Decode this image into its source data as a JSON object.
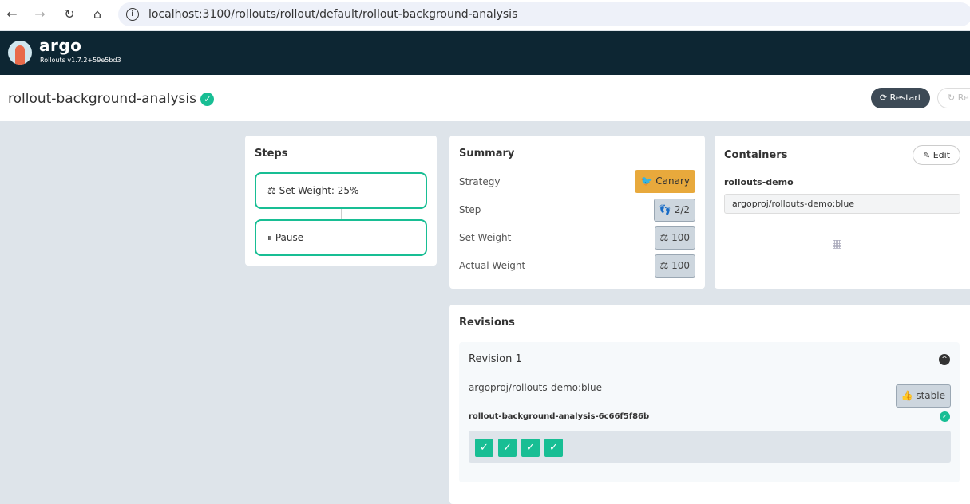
{
  "browser": {
    "url": "localhost:3100/rollouts/rollout/default/rollout-background-analysis"
  },
  "header": {
    "brand": "argo",
    "version": "Rollouts v1.7.2+59e5bd3"
  },
  "page": {
    "title": "rollout-background-analysis",
    "restart_label": "Restart",
    "retry_label": "Re"
  },
  "steps": {
    "title": "Steps",
    "items": [
      "Set Weight: 25%",
      "Pause"
    ]
  },
  "summary": {
    "title": "Summary",
    "rows": [
      {
        "label": "Strategy",
        "value": "Canary"
      },
      {
        "label": "Step",
        "value": "2/2"
      },
      {
        "label": "Set Weight",
        "value": "100"
      },
      {
        "label": "Actual Weight",
        "value": "100"
      }
    ]
  },
  "containers": {
    "title": "Containers",
    "edit_label": "Edit",
    "name": "rollouts-demo",
    "image": "argoproj/rollouts-demo:blue"
  },
  "revisions": {
    "title": "Revisions",
    "items": [
      {
        "title": "Revision 1",
        "image": "argoproj/rollouts-demo:blue",
        "badge": "stable",
        "replicaset": "rollout-background-analysis-6c66f5f86b",
        "pods": 4
      }
    ]
  },
  "colors": {
    "accent": "#18be94",
    "header": "#0d2633",
    "canary": "#e8a93c"
  }
}
